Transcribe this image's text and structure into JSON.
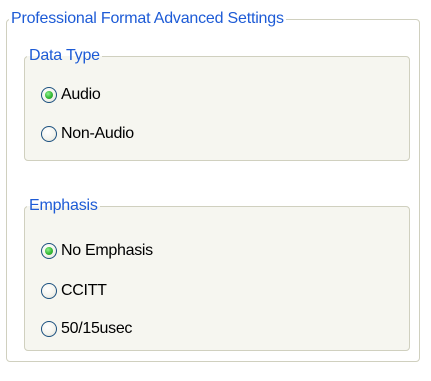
{
  "groups": {
    "outer": {
      "legend": "Professional Format Advanced Settings"
    },
    "data_type": {
      "legend": "Data Type",
      "options": [
        {
          "label": "Audio",
          "checked": true
        },
        {
          "label": "Non-Audio",
          "checked": false
        }
      ]
    },
    "emphasis": {
      "legend": "Emphasis",
      "options": [
        {
          "label": "No Emphasis",
          "checked": true
        },
        {
          "label": "CCITT",
          "checked": false
        },
        {
          "label": "50/15usec",
          "checked": false
        }
      ]
    }
  },
  "colors": {
    "legend_text": "#1d5bd6",
    "group_border": "#d0d0bf",
    "group_background": "#f6f6f0",
    "radio_border": "#1c5180",
    "radio_dot": "#36b936"
  }
}
